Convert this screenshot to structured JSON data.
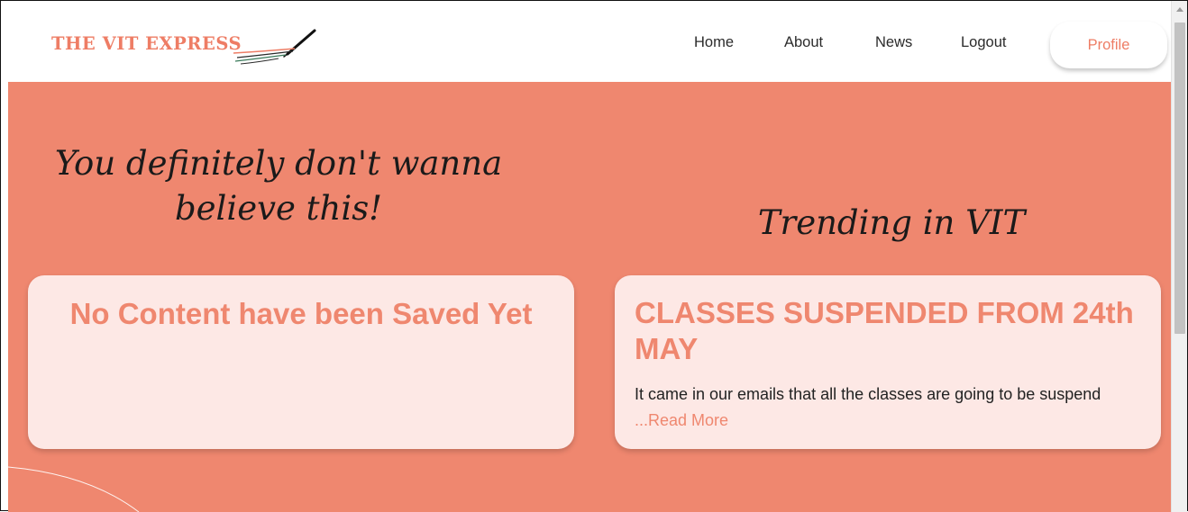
{
  "header": {
    "logo_text": "THE VIT EXPRESS",
    "logo_icon": "pen-icon",
    "nav": {
      "home": "Home",
      "about": "About",
      "news": "News",
      "logout": "Logout"
    },
    "profile_label": "Profile"
  },
  "saved_section": {
    "heading_line1": "You definitely don't wanna",
    "heading_line2": "believe this!",
    "empty_message": "No Content have been Saved Yet"
  },
  "trending_section": {
    "heading": "Trending in VIT",
    "article": {
      "title": "CLASSES SUSPENDED FROM 24th MAY",
      "excerpt": "It came in our emails that all the classes are going to be suspend",
      "read_more": "...Read More"
    }
  },
  "colors": {
    "accent": "#ef876f",
    "card_bg": "#fde8e5",
    "header_bg": "#ffffff",
    "text_dark": "#222222"
  }
}
